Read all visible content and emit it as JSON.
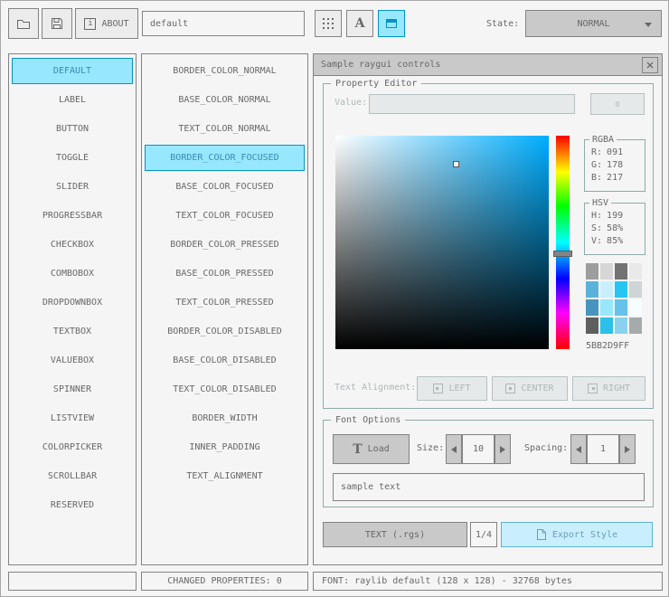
{
  "toolbar": {
    "about_icon": "i",
    "about_label": "ABOUT",
    "style_name": "default",
    "font_button_label": "A",
    "state_label": "State:",
    "state_value": "NORMAL"
  },
  "controls": {
    "items": [
      "DEFAULT",
      "LABEL",
      "BUTTON",
      "TOGGLE",
      "SLIDER",
      "PROGRESSBAR",
      "CHECKBOX",
      "COMBOBOX",
      "DROPDOWNBOX",
      "TEXTBOX",
      "VALUEBOX",
      "SPINNER",
      "LISTVIEW",
      "COLORPICKER",
      "SCROLLBAR",
      "RESERVED"
    ],
    "selected": "DEFAULT"
  },
  "properties": {
    "items": [
      "BORDER_COLOR_NORMAL",
      "BASE_COLOR_NORMAL",
      "TEXT_COLOR_NORMAL",
      "BORDER_COLOR_FOCUSED",
      "BASE_COLOR_FOCUSED",
      "TEXT_COLOR_FOCUSED",
      "BORDER_COLOR_PRESSED",
      "BASE_COLOR_PRESSED",
      "TEXT_COLOR_PRESSED",
      "BORDER_COLOR_DISABLED",
      "BASE_COLOR_DISABLED",
      "TEXT_COLOR_DISABLED",
      "BORDER_WIDTH",
      "INNER_PADDING",
      "TEXT_ALIGNMENT"
    ],
    "selected": "BORDER_COLOR_FOCUSED"
  },
  "sample_window": {
    "title": "Sample raygui controls"
  },
  "property_editor": {
    "group_label": "Property Editor",
    "value_label": "Value:",
    "value_text": "",
    "value_button_label": "0",
    "rgba_label": "RGBA",
    "rgba_rows": [
      {
        "label": "R:",
        "value": "091"
      },
      {
        "label": "G:",
        "value": "178"
      },
      {
        "label": "B:",
        "value": "217"
      }
    ],
    "hsv_label": "HSV",
    "hsv_rows": [
      {
        "label": "H:",
        "value": "199"
      },
      {
        "label": "S:",
        "value": "58%"
      },
      {
        "label": "V:",
        "value": "85%"
      }
    ],
    "hex_value": "5BB2D9FF",
    "swatches": [
      "#9d9d9d",
      "#d6d6d6",
      "#737373",
      "#e9e9e9",
      "#5bb2d9",
      "#c9effe",
      "#29c5f2",
      "#cfd5d6",
      "#4795be",
      "#97e8ff",
      "#66c2e8",
      "#f6fdff",
      "#5f5f5f",
      "#2bc0e8",
      "#8ad1ee",
      "#a5abab"
    ],
    "alignment_label": "Text Alignment:",
    "alignment_buttons": [
      "LEFT",
      "CENTER",
      "RIGHT"
    ]
  },
  "font_options": {
    "group_label": "Font Options",
    "load_icon": "T",
    "load_label": "Load",
    "size_label": "Size:",
    "size_value": "10",
    "spacing_label": "Spacing:",
    "spacing_value": "1",
    "sample_text": "sample text"
  },
  "export_bar": {
    "format_label": "TEXT (.rgs)",
    "page_indicator": "1/4",
    "export_label": "Export Style"
  },
  "statusbar": {
    "changed_properties": "CHANGED PROPERTIES: 0",
    "font_info": "FONT: raylib default (128 x 128) - 32768 bytes"
  },
  "colors": {
    "picked_color": "#5bb2d9",
    "accent_border": "#0492c7",
    "accent_base": "#97e8ff",
    "focused_border": "#5bb2d9",
    "focused_base": "#c9effe",
    "hue_full": "#00aeff"
  }
}
